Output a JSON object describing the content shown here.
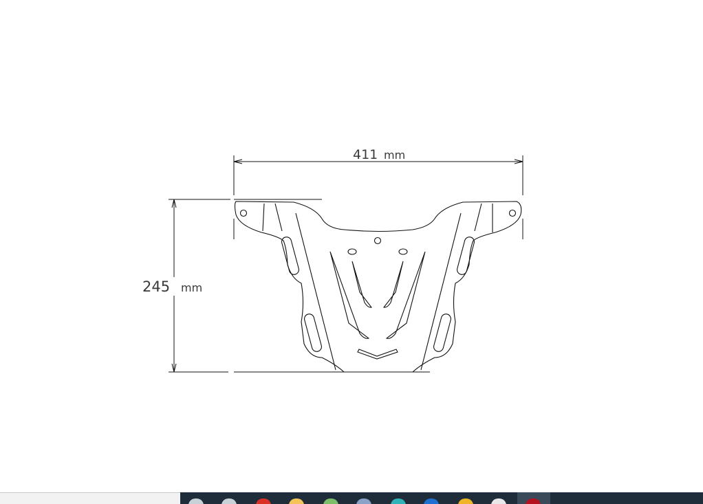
{
  "drawing": {
    "width_dimension": {
      "value": "411",
      "unit": "mm"
    },
    "height_dimension": {
      "value": "245",
      "unit": "mm"
    }
  },
  "taskbar": {
    "icons": [
      {
        "name": "search-icon",
        "color": "#c9d1d8"
      },
      {
        "name": "task-view-icon",
        "color": "#c9d1d8"
      },
      {
        "name": "chrome-icon",
        "color": "#d93025"
      },
      {
        "name": "file-explorer-folder-icon",
        "color": "#f3c45a"
      },
      {
        "name": "spreadsheet-app-icon",
        "color": "#7cbf6b"
      },
      {
        "name": "calculator-app-icon",
        "color": "#8aa2c8"
      },
      {
        "name": "edge-browser-icon",
        "color": "#2fb3b8"
      },
      {
        "name": "outlook-mail-icon",
        "color": "#1f6fd0"
      },
      {
        "name": "folder-icon",
        "color": "#f0b429"
      },
      {
        "name": "circular-app-icon",
        "color": "#e8e8e8"
      },
      {
        "name": "pdf-reader-icon",
        "color": "#b3121e"
      }
    ]
  }
}
